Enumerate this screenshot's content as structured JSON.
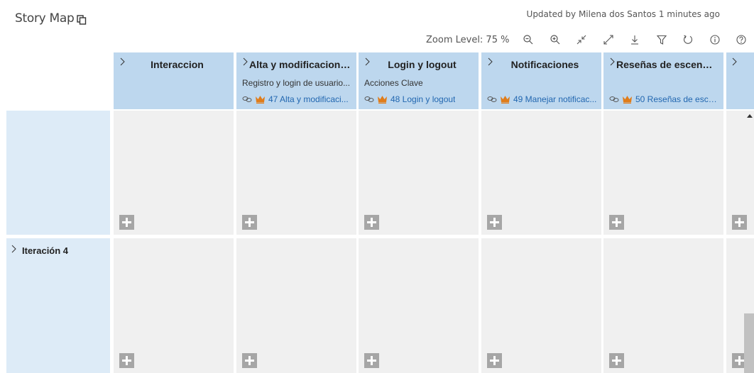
{
  "page": {
    "title": "Story Map",
    "updated": "Updated by Milena dos Santos 1 minutes ago"
  },
  "toolbar": {
    "zoom_label": "Zoom Level: 75 %",
    "buttons": [
      "zoom-out-icon",
      "zoom-in-icon",
      "collapse-icon",
      "expand-icon",
      "download-icon",
      "filter-icon",
      "refresh-icon",
      "info-icon",
      "help-icon"
    ]
  },
  "columns": [
    {
      "title": "Interaccion",
      "subtitle": "",
      "link": ""
    },
    {
      "title": "Alta y modificacion ...",
      "subtitle": "Registro y login de usuario...",
      "link": "47 Alta y modificaci..."
    },
    {
      "title": "Login y logout",
      "subtitle": "Acciones Clave",
      "link": "48 Login y logout"
    },
    {
      "title": "Notificaciones",
      "subtitle": "",
      "link": "49 Manejar notificac..."
    },
    {
      "title": "Reseñas de escenari...",
      "subtitle": "",
      "link": "50 Reseñas de escen..."
    }
  ],
  "rows": [
    {
      "title": ""
    },
    {
      "title": "Iteración 4"
    }
  ],
  "colors": {
    "header_bg": "#bdd7ee",
    "row_label_bg": "#ddebf7",
    "cell_bg": "#f0f0f0",
    "add_btn": "#a6a6a6",
    "link": "#2267b0",
    "crown": "#e07c1a"
  }
}
